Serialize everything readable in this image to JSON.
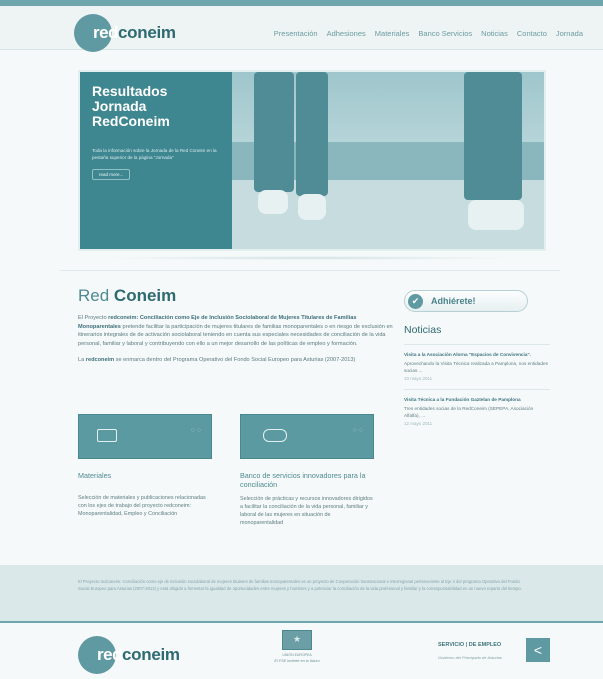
{
  "header": {
    "logo": {
      "prefix": "red",
      "rest": "coneim"
    },
    "nav": [
      "Presentación",
      "Adhesiones",
      "Materiales",
      "Banco Servicios",
      "Noticias",
      "Contacto",
      "Jornada"
    ]
  },
  "hero": {
    "title": "Resultados Jornada RedConeim",
    "text": "Toda la información sobre la Jornada de la Red Coneim en la pestaña superior de la página \"Jornada\"",
    "more": "read more..."
  },
  "main": {
    "title_a": "Red",
    "title_b": "Coneim",
    "p1_a": "El Proyecto",
    "p1_b": "redconeim: Conciliación como Eje de Inclusión Sociolaboral de Mujeres Titulares de Familias Monoparentales",
    "p1_c": "pretende facilitar la participación de mujeres titulares de familias monoparentales o en riesgo de exclusión en itinerarios integrales de de activación sociolaboral teniendo en cuenta sus especiales necesidades de conciliación de la vida personal, familiar y laboral y contribuyendo con ello a un mejor desarrollo de las políticas de empleo y formación.",
    "p2_a": "La",
    "p2_b": "redconeim",
    "p2_c": "se enmarca dentro del Programa Operativo del Fondo Social Europeo para Asturias (2007-2013)"
  },
  "cards": [
    {
      "title": "Materiales",
      "text": "Selección de materiales y publicaciones relacionadas con los ejes de trabajo del proyecto redconeim: Monoparentalidad, Empleo y Conciliación"
    },
    {
      "title": "Banco de servicios innovadores para la conciliación",
      "text": "Selección de prácticas y recursos innovadores dirigidos a facilitar la conciliación de la vida personal, familiar y laboral de las mujeres en situación de monoparentalidad"
    }
  ],
  "sidebar": {
    "join_label": "Adhiérete!",
    "news_title": "Noticias",
    "news": [
      {
        "title": "Visita a la Asociación Alorna \"Espacios de Convivencia\".",
        "body": "Aprovechando la Visita Técnica realizada a Pamplona, nos entidades socias ...",
        "date": "10 mayo 2011"
      },
      {
        "title": "Visita Técnica a la Fundación Gaztelan de Pamplona",
        "body": "Tres entidades socias de la RedConeim (SEPEPA, Asociación Alfalfa), ...",
        "date": "12 mayo 2011"
      }
    ]
  },
  "footer": {
    "text": "El Proyecto redconeim: Conciliación como eje de inclusión sociolaboral de mujeres titulares de familias monoparentales es un proyecto de Cooperación transnacional e interregional perteneciente al Eje 4 del programa Operativo del Fondo Social Europeo para Asturias (2007-2013) y está dirigido a fomentar la igualdad de oportunidades entre mujeres y hombres y a potenciar la conciliación de la vida profesional y familiar y la corresponsabilidad en un nuevo reparto del tiempo.",
    "eu_line1": "UNIÓN EUROPEA",
    "eu_line2": "El FSE invierte en tu futuro",
    "servicio_a": "SERVICIO",
    "servicio_b": "DE EMPLEO",
    "servicio_sub": "Gobierno del Principado de Asturias"
  }
}
